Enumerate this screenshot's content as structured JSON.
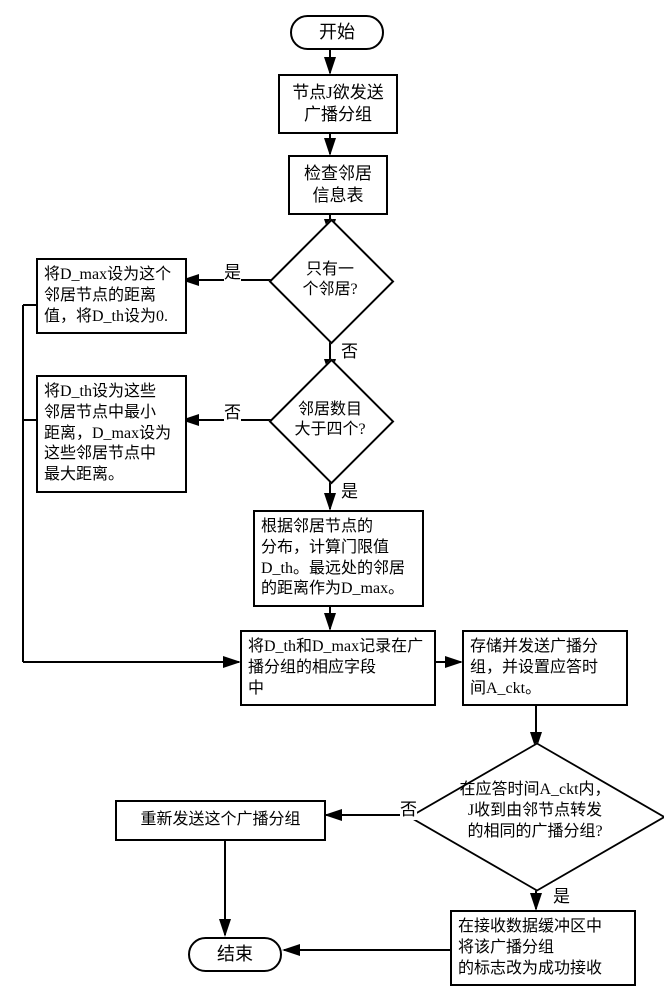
{
  "nodes": {
    "start": "开始",
    "send_broadcast": "节点J欲发送\n广播分组",
    "check_neighbor": "检查邻居\n信息表",
    "only_one_neighbor": "只有一\n个邻居?",
    "set_dmax_one": "将D_max设为这个\n邻居节点的距离\n值，将D_th设为0.",
    "neighbor_gt_four": "邻居数目\n大于四个?",
    "set_dth_minmax": "将D_th设为这些\n邻居节点中最小\n距离，D_max设为\n这些邻居节点中\n最大距离。",
    "compute_threshold": "根据邻居节点的\n分布，计算门限值\nD_th。最远处的邻居\n的距离作为D_max。",
    "record_fields": "将D_th和D_max记录在广\n播分组的相应字段\n中",
    "store_send": "存储并发送广播分\n组，并设置应答时\n间A_ckt。",
    "ack_received": "在应答时间A_ckt内，\nJ收到由邻节点转发\n的相同的广播分组?",
    "resend": "重新发送这个广播分组",
    "mark_success": "在接收数据缓冲区中\n将该广播分组\n的标志改为成功接收",
    "end": "结束"
  },
  "labels": {
    "yes": "是",
    "no": "否"
  }
}
